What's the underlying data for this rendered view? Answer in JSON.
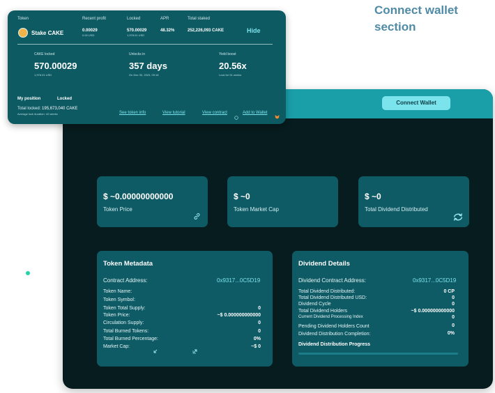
{
  "caption": "Connect wallet section",
  "header": {
    "connect_label": "Connect Wallet"
  },
  "stats": [
    {
      "value": "$ ~0.00000000000",
      "label": "Token Price",
      "icon": "link-icon"
    },
    {
      "value": "$ ~0",
      "label": "Token Market Cap"
    },
    {
      "value": "$ ~0",
      "label": "Total Dividend Distributed",
      "icon": "refresh-icon"
    }
  ],
  "metadata": {
    "title": "Token Metadata",
    "contract_label": "Contract Address:",
    "contract_value": "0x9317...0C5D19",
    "rows": [
      {
        "label": "Token Name:",
        "value": ""
      },
      {
        "label": "Token Symbol:",
        "value": ""
      },
      {
        "label": "Token Total Supply:",
        "value": "0"
      },
      {
        "label": "Token Price:",
        "value": "~$ 0.000000000000"
      },
      {
        "label": "Circulation Supply:",
        "value": "0"
      },
      {
        "label": "Total Burned Tokens:",
        "value": "0"
      },
      {
        "label": "Total Burned Percentage:",
        "value": "0%"
      },
      {
        "label": "Market Cap:",
        "value": "~$ 0"
      }
    ]
  },
  "dividend": {
    "title": "Dividend Details",
    "contract_label": "Dividend Contract Address:",
    "contract_value": "0x9317...0C5D19",
    "rows": [
      {
        "label": "Total Dividend Distributed:",
        "value": "0 CP"
      },
      {
        "label": "Total Dividend Distributed USD:",
        "value": "0"
      },
      {
        "label": "Dividend Cycle",
        "value": "0"
      },
      {
        "label": "Total Dividend Holders",
        "value": "~$ 0.000000000000"
      },
      {
        "label": "Current Dividend Processing Index",
        "value": "0"
      },
      {
        "label": "Pending Dividend Holders Count",
        "value": "0"
      },
      {
        "label": "Dividend Distribution Completion:",
        "value": "0%"
      }
    ],
    "progress_label": "Dividend Distribution Progress",
    "progress_fraction": 0.0
  },
  "stake_panel": {
    "col_token": "Token",
    "col_profit": "Recent profit",
    "col_locked": "Locked",
    "col_apr": "APR",
    "col_total_staked": "Total staked",
    "token_name": "Stake CAKE",
    "profit": "0.00029",
    "profit_usd": "0.00 USD",
    "locked": "570.00029",
    "locked_usd": "1,978.01 USD",
    "apr": "48.32%",
    "total_staked": "252,226,093 CAKE",
    "hide_label": "Hide",
    "cake_locked_label": "CAKE locked",
    "cake_locked_value": "570.00029",
    "cake_locked_sub": "1,978.01 USD",
    "unlocks_label": "Unlocks in",
    "unlocks_value": "357 days",
    "unlocks_sub": "On Dec 30, 2023, 09:18",
    "yield_label": "Yield boost",
    "yield_value": "20.56x",
    "yield_sub": "Lock for 51 weeks",
    "my_position": "My position",
    "locked_tag": "Locked",
    "total_locked_label": "Total locked:",
    "total_locked_value": "195,673,040 CAKE",
    "avg_lock": "Average lock duration: 42 weeks",
    "link_token_info": "See token info",
    "link_tutorial": "View tutorial",
    "link_contract": "View contract",
    "link_add_wallet": "Add to Wallet"
  },
  "colors": {
    "accent": "#7be3ec",
    "card": "#0f5b65",
    "background": "#071c1e",
    "header": "#1a9ea8"
  }
}
